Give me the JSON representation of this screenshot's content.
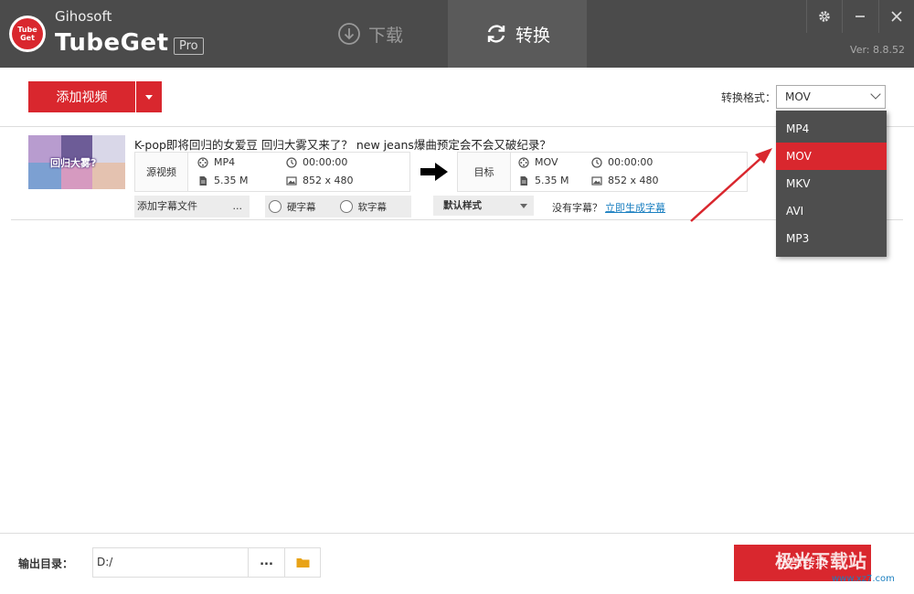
{
  "app": {
    "vendor": "Gihosoft",
    "name": "TubeGet",
    "edition": "Pro",
    "logo_text_top": "Tube",
    "logo_text_bottom": "Get",
    "version": "Ver: 8.8.52"
  },
  "tabs": [
    {
      "label": "下载",
      "icon": "download-circle-icon",
      "active": false
    },
    {
      "label": "转换",
      "icon": "refresh-icon",
      "active": true
    }
  ],
  "window_controls": [
    "gear-icon",
    "minimize-icon",
    "close-icon"
  ],
  "toolbar": {
    "add_label": "添加视频",
    "format_label": "转换格式：",
    "format_value": "MOV"
  },
  "format_options": [
    {
      "label": "MP4",
      "selected": false
    },
    {
      "label": "MOV",
      "selected": true
    },
    {
      "label": "MKV",
      "selected": false
    },
    {
      "label": "AVI",
      "selected": false
    },
    {
      "label": "MP3",
      "selected": false
    }
  ],
  "video": {
    "title": "K-pop即将回归的女爱豆 回归大雾又来了？ new jeans爆曲预定会不会又破纪录？",
    "thumb_text": "回归大雾?",
    "source": {
      "tag": "源视频",
      "format": "MP4",
      "duration": "00:00:00",
      "size": "5.35 M",
      "resolution": "852 x 480"
    },
    "target": {
      "tag": "目标",
      "format": "MOV",
      "duration": "00:00:00",
      "size": "5.35 M",
      "resolution": "852 x 480"
    },
    "subtitle_file": "添加字幕文件",
    "subtitle_file_dots": "...",
    "hard_sub": "硬字幕",
    "soft_sub": "软字幕",
    "style": "默认样式",
    "no_subtitle": "没有字幕？",
    "generate_subtitle": "立即生成字幕"
  },
  "footer": {
    "output_label": "输出目录：",
    "output_path": "D:/",
    "browse_dots": "...",
    "convert_all": "全部转换"
  },
  "watermark": {
    "text": "极光下载站",
    "url": "www.xz7.com"
  },
  "colors": {
    "accent": "#d9272e",
    "titlebar": "#4b4b4b",
    "dropdown_bg": "#4e4e4e",
    "link": "#1a7fc0"
  }
}
